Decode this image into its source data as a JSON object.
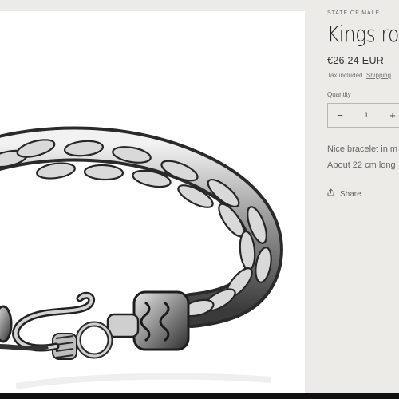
{
  "product": {
    "vendor": "STATE OF MALE",
    "title": "Kings rope",
    "price": "€26,24 EUR",
    "tax_prefix": "Tax included.",
    "tax_link": "Shipping",
    "quantity_label": "Quantity",
    "quantity_value": "1",
    "quantity_minus": "−",
    "quantity_plus": "+",
    "description_line1": "Nice bracelet in m",
    "description_line2": "About 22 cm long",
    "share_label": "Share"
  },
  "icons": {
    "share": "share-icon"
  },
  "colors": {
    "background": "#edebe8",
    "image_background": "#ffffff",
    "text": "#3a3a3a"
  }
}
